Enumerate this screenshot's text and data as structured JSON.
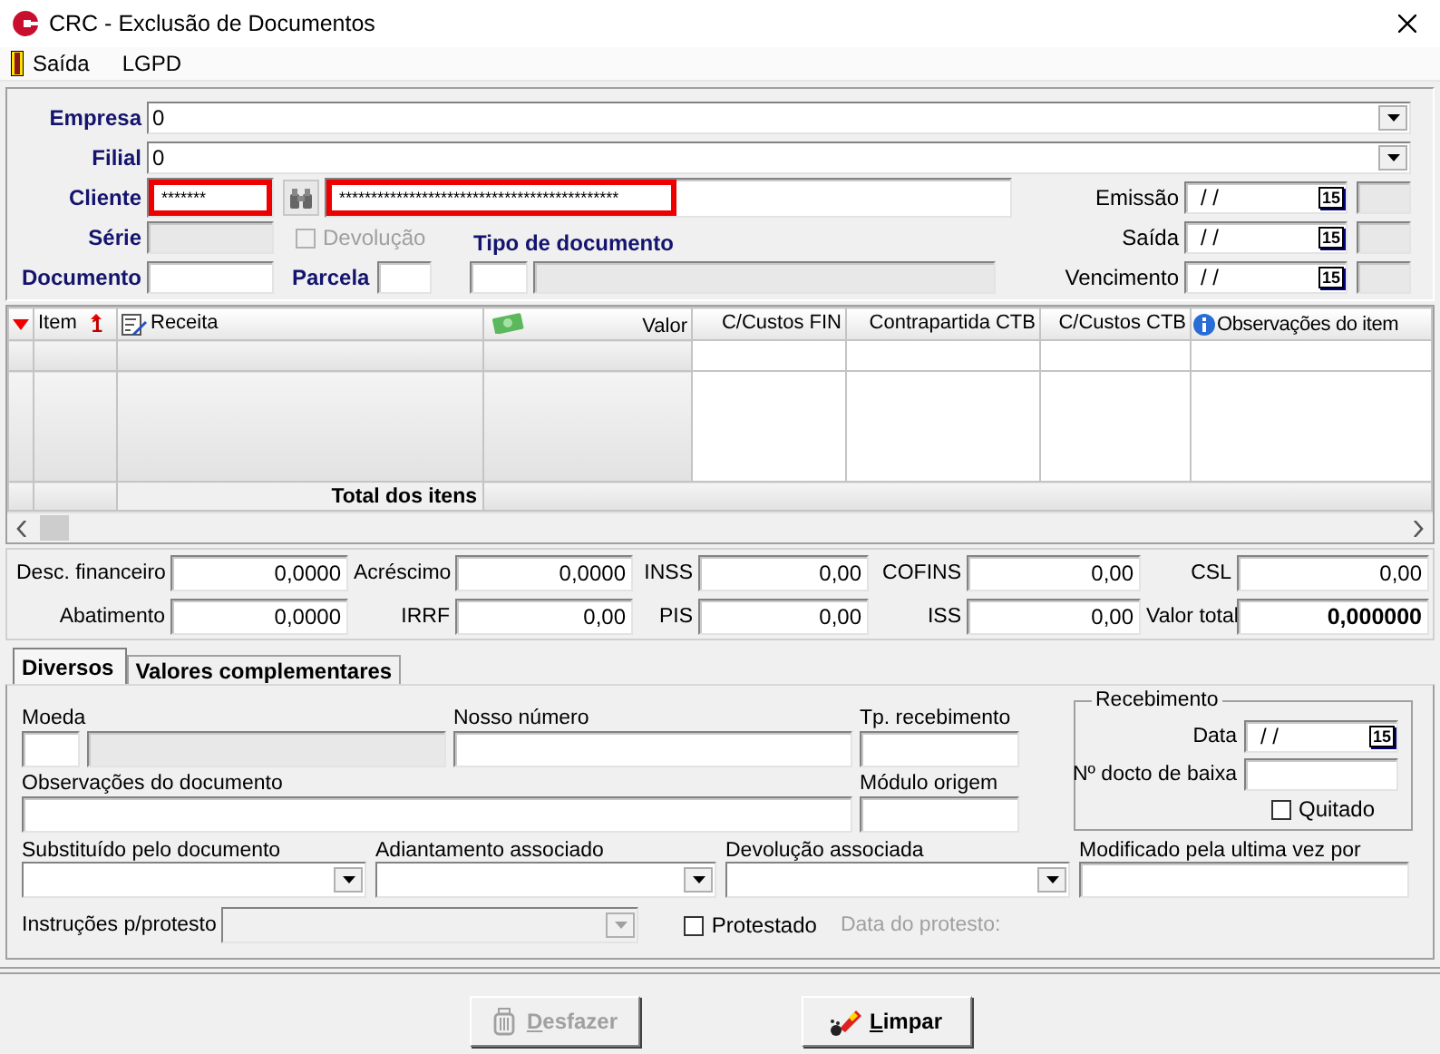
{
  "window": {
    "title": "CRC - Exclusão de Documentos"
  },
  "menu": [
    {
      "label": "Saída",
      "kind": "icon"
    },
    {
      "label": "LGPD",
      "kind": "plain"
    }
  ],
  "header": {
    "empresa": {
      "label": "Empresa",
      "value": "0"
    },
    "filial": {
      "label": "Filial",
      "value": "0"
    },
    "cliente": {
      "label": "Cliente",
      "code": "*******",
      "name": "********************************************",
      "highlighted": true
    },
    "serie": {
      "label": "Série",
      "disabled": true
    },
    "devolucao": {
      "label": "Devolução",
      "checked": false,
      "disabled": true
    },
    "tipo_documento": {
      "label": "Tipo de documento",
      "description_disabled": true
    },
    "documento": {
      "label": "Documento"
    },
    "parcela": {
      "label": "Parcela"
    },
    "dates": [
      {
        "label": "Emissão",
        "value": "/ /",
        "calendar": "15"
      },
      {
        "label": "Saída",
        "value": "/ /",
        "calendar": "15"
      },
      {
        "label": "Vencimento",
        "value": "/ /",
        "calendar": "15"
      }
    ]
  },
  "grid": {
    "columns": [
      {
        "label": "Item",
        "badge": "1"
      },
      {
        "label": "Receita"
      },
      {
        "label": "Valor"
      },
      {
        "label": "C/Custos FIN"
      },
      {
        "label": "Contrapartida CTB"
      },
      {
        "label": "C/Custos CTB"
      },
      {
        "label": "Observações do item"
      }
    ],
    "total_label": "Total dos itens"
  },
  "totals": [
    {
      "label": "Desc. financeiro",
      "value": "0,0000",
      "emphasis": false
    },
    {
      "label": "Acréscimo",
      "value": "0,0000",
      "emphasis": false
    },
    {
      "label": "INSS",
      "value": "0,00",
      "emphasis": false
    },
    {
      "label": "COFINS",
      "value": "0,00",
      "emphasis": false
    },
    {
      "label": "CSL",
      "value": "0,00",
      "emphasis": false
    },
    {
      "label": "Abatimento",
      "value": "0,0000",
      "emphasis": false
    },
    {
      "label": "IRRF",
      "value": "0,00",
      "emphasis": false
    },
    {
      "label": "PIS",
      "value": "0,00",
      "emphasis": false
    },
    {
      "label": "ISS",
      "value": "0,00",
      "emphasis": false
    },
    {
      "label": "Valor total",
      "value": "0,000000",
      "emphasis": true
    }
  ],
  "tabs": [
    {
      "label": "Diversos",
      "selected": true
    },
    {
      "label": "Valores complementares",
      "selected": false
    }
  ],
  "diversos": {
    "moeda": {
      "label": "Moeda",
      "description_disabled": true
    },
    "nosso_numero": {
      "label": "Nosso número"
    },
    "tp_recebimento": {
      "label": "Tp. recebimento"
    },
    "observacoes": {
      "label": "Observações do documento"
    },
    "modulo_origem": {
      "label": "Módulo origem"
    },
    "recebimento": {
      "title": "Recebimento",
      "data_label": "Data",
      "data_value": "/ /",
      "calendar": "15",
      "baixa_label": "Nº docto de baixa",
      "quitado": {
        "label": "Quitado",
        "checked": false
      }
    },
    "combos": [
      {
        "label": "Substituído pelo documento"
      },
      {
        "label": "Adiantamento associado"
      },
      {
        "label": "Devolução associada"
      }
    ],
    "modificado": {
      "label": "Modificado pela ultima vez por"
    },
    "instrucoes": {
      "label": "Instruções p/protesto",
      "disabled": true
    },
    "protestado": {
      "label": "Protestado",
      "checked": false
    },
    "data_protesto": {
      "label": "Data do protesto:",
      "disabled": true
    }
  },
  "buttons": [
    {
      "label": "Desfazer",
      "disabled": true
    },
    {
      "label": "Limpar",
      "disabled": false
    }
  ]
}
